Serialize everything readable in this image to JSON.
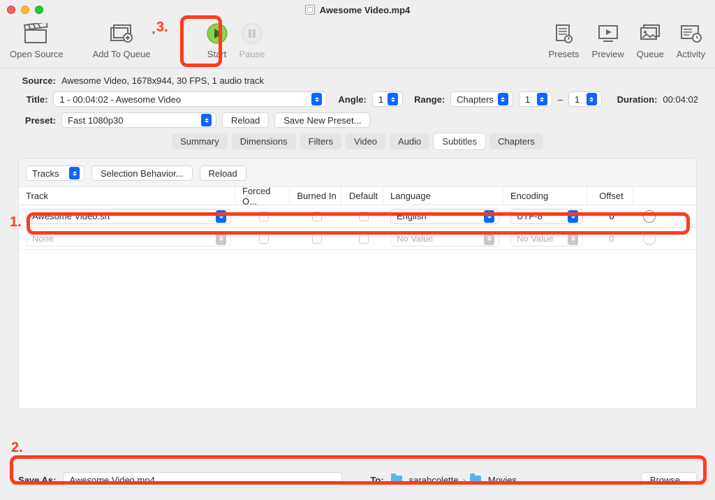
{
  "window": {
    "title": "Awesome Video.mp4"
  },
  "toolbar": {
    "open_source": "Open Source",
    "add_to_queue": "Add To Queue",
    "start": "Start",
    "pause": "Pause",
    "presets": "Presets",
    "preview": "Preview",
    "queue": "Queue",
    "activity": "Activity"
  },
  "source": {
    "label": "Source:",
    "value": "Awesome Video, 1678x944, 30 FPS, 1 audio track"
  },
  "title": {
    "label": "Title:",
    "value": "1 - 00:04:02 - Awesome Video"
  },
  "angle": {
    "label": "Angle:",
    "value": "1"
  },
  "range": {
    "label": "Range:",
    "mode": "Chapters",
    "from": "1",
    "dash": "–",
    "to": "1"
  },
  "duration": {
    "label": "Duration:",
    "value": "00:04:02"
  },
  "preset_row": {
    "label": "Preset:",
    "value": "Fast 1080p30",
    "reload": "Reload",
    "save_new": "Save New Preset..."
  },
  "tabs": [
    "Summary",
    "Dimensions",
    "Filters",
    "Video",
    "Audio",
    "Subtitles",
    "Chapters"
  ],
  "tabs_active_index": 5,
  "sub_toolbar": {
    "tracks": "Tracks",
    "selection_behavior": "Selection Behavior...",
    "reload": "Reload"
  },
  "sub_headers": {
    "track": "Track",
    "forced": "Forced O...",
    "burned": "Burned In",
    "default": "Default",
    "language": "Language",
    "encoding": "Encoding",
    "offset": "Offset"
  },
  "sub_rows": [
    {
      "track": "Awesome Video.srt",
      "language": "English",
      "encoding": "UTF-8",
      "offset": "0"
    },
    {
      "track": "None",
      "language": "No Value",
      "encoding": "No Value",
      "offset": "0"
    }
  ],
  "save": {
    "label": "Save As:",
    "value": "Awesome Video.mp4",
    "to_label": "To:",
    "path_user": "sarahcolette",
    "path_sep": "›",
    "path_dir": "Movies",
    "browse": "Browse..."
  },
  "annotations": {
    "n1": "1.",
    "n2": "2.",
    "n3": "3."
  }
}
